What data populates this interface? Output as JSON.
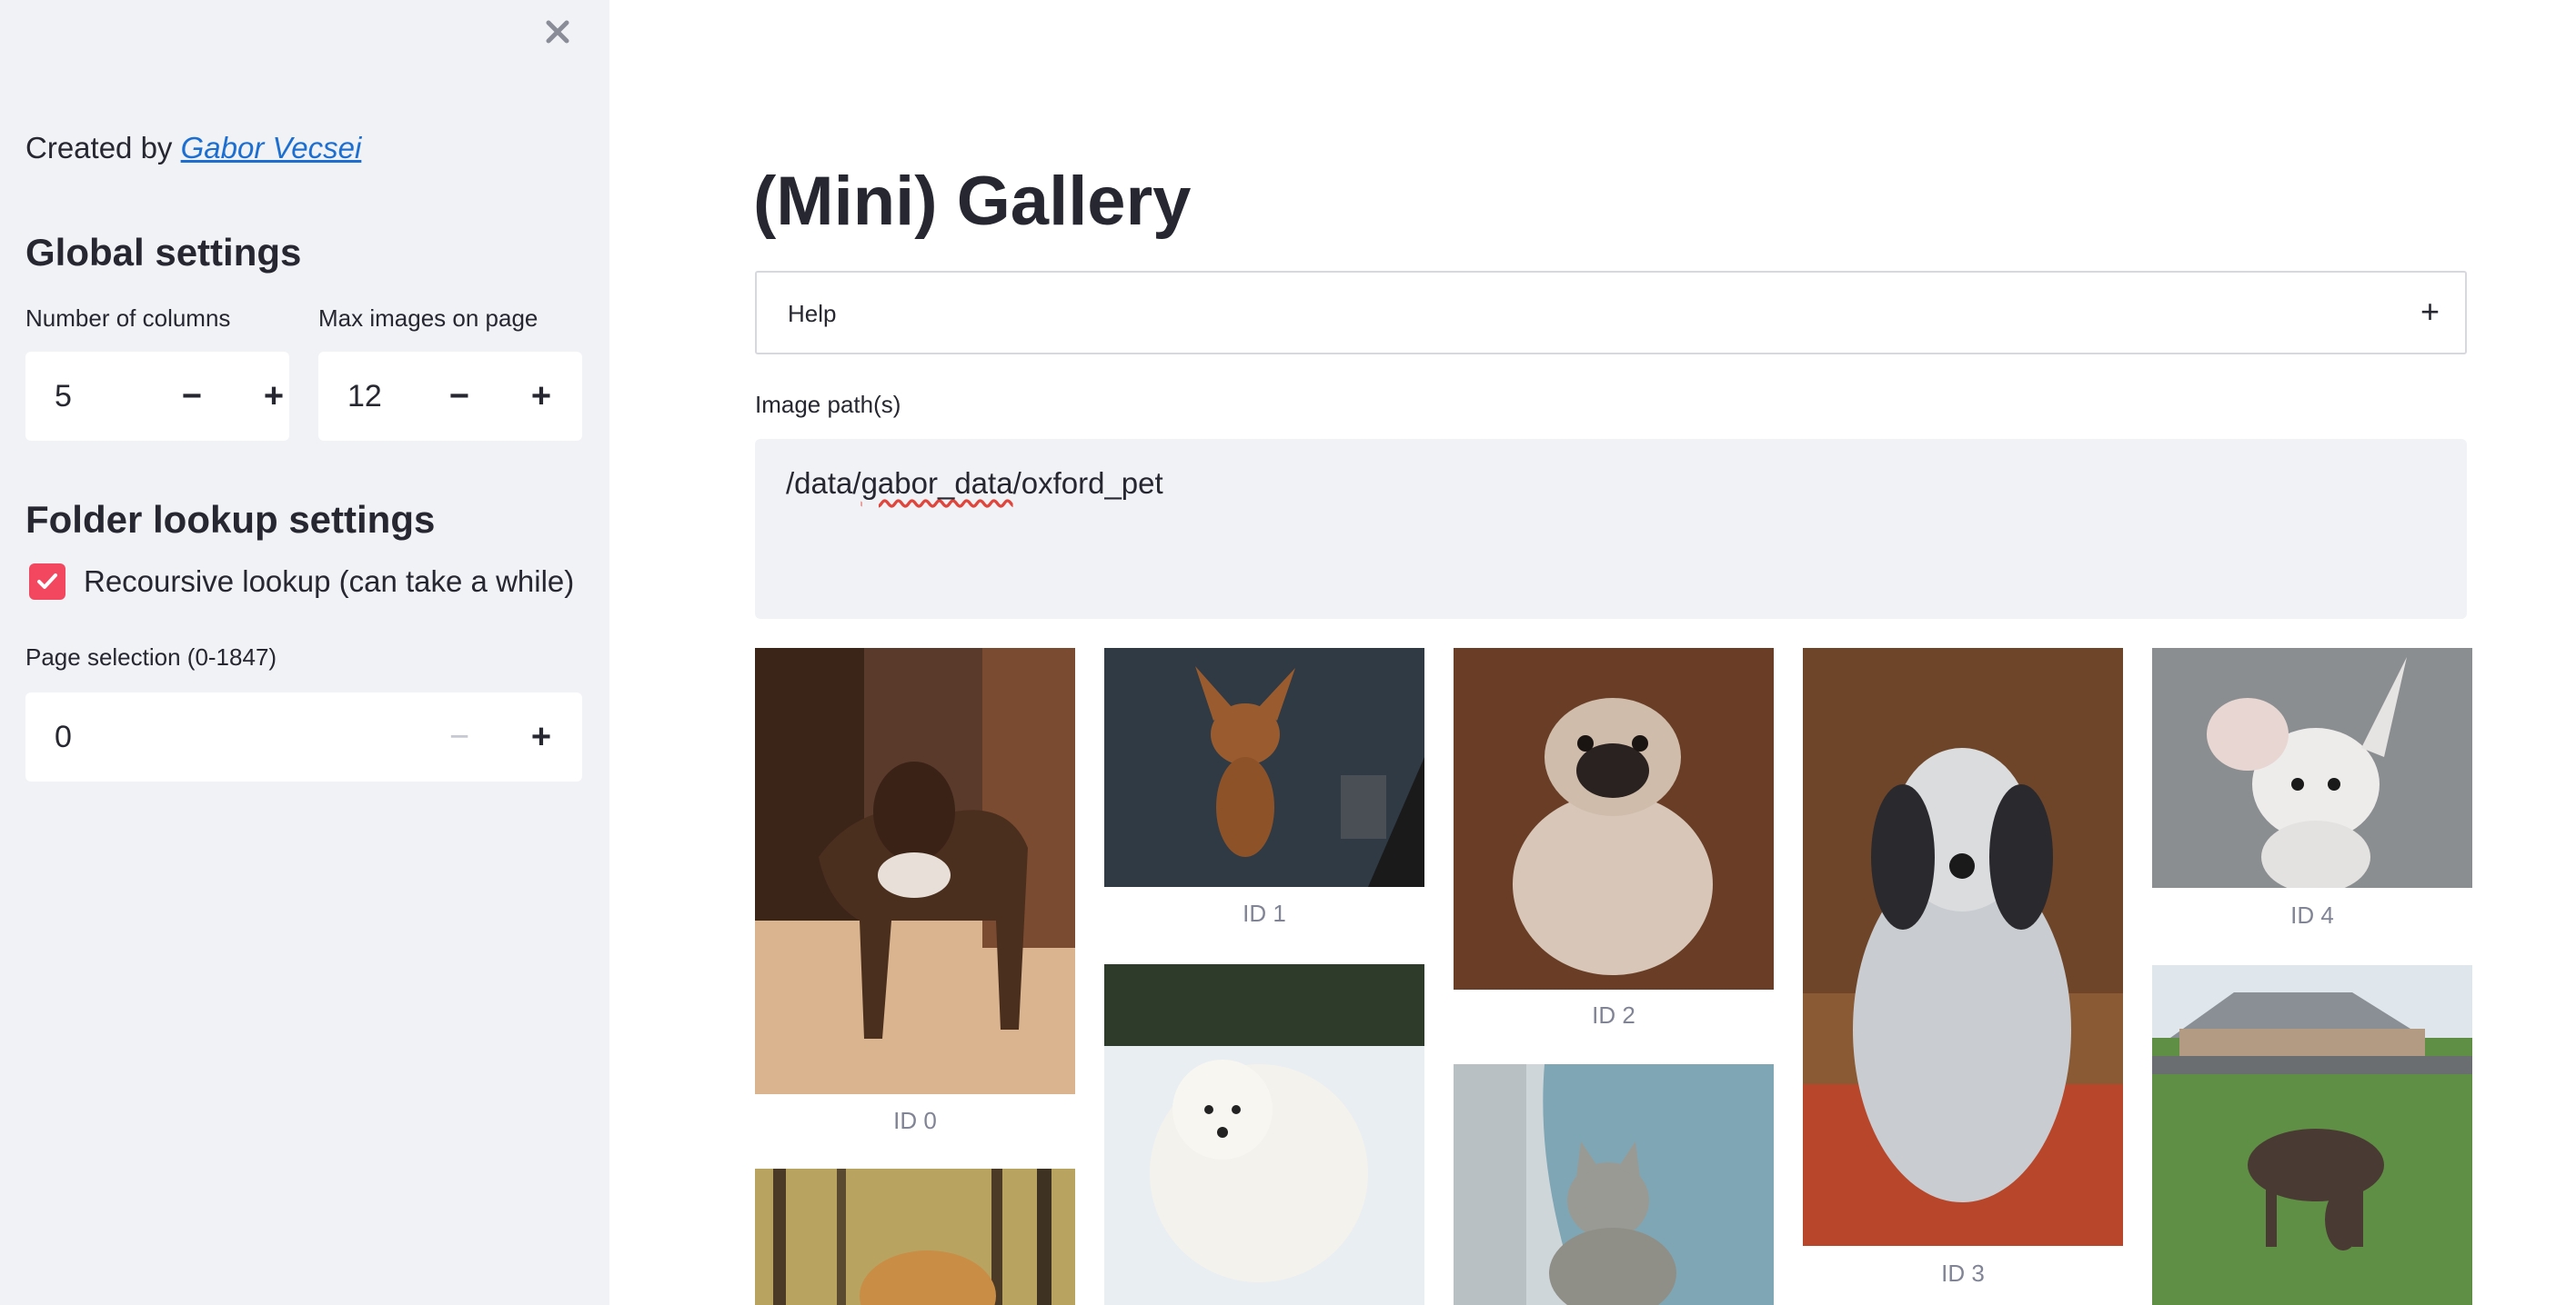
{
  "sidebar": {
    "created_prefix": "Created by",
    "author_link": "Gabor Vecsei",
    "global_heading": "Global settings",
    "columns": {
      "label": "Number of columns",
      "value": "5",
      "minus": "−",
      "plus": "+"
    },
    "max_images": {
      "label": "Max images on page",
      "value": "12",
      "minus": "−",
      "plus": "+"
    },
    "folder_heading": "Folder lookup settings",
    "recursive": {
      "label": "Recoursive lookup (can take a while)",
      "checked": true
    },
    "page_selection": {
      "label": "Page selection (0-1847)",
      "value": "0",
      "minus": "−",
      "plus": "+"
    }
  },
  "main": {
    "title": "(Mini) Gallery",
    "help_label": "Help",
    "help_icon": "+",
    "path_label": "Image path(s)",
    "path_pre": "/data/",
    "path_spell": "gabor_data",
    "path_post": "/oxford_pet"
  },
  "gallery": {
    "captions": [
      "ID 0",
      "ID 1",
      "ID 2",
      "ID 3",
      "ID 4"
    ],
    "images": [
      "boxer-dog",
      "chihuahua-brown",
      "pug",
      "english-setter",
      "chihuahua-white",
      "samoyed",
      "tabby-cat",
      "german-shorthaired-pointer",
      "cocker-spaniel"
    ]
  },
  "colors": {
    "accent": "#f2475f",
    "link": "#1c6fd1",
    "sidebar_bg": "#f0f2f6",
    "caption": "#808495"
  }
}
